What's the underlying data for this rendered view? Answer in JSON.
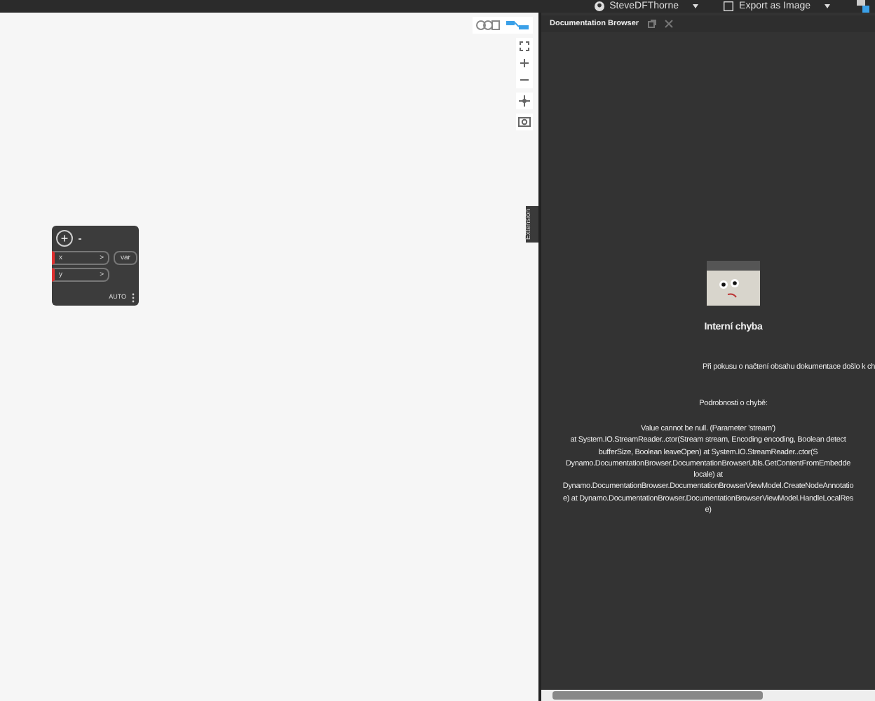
{
  "top_bar": {
    "user": "SteveDFThorne",
    "export": "Export as Image"
  },
  "node": {
    "inputs": [
      {
        "name": "x",
        "arrow": ">"
      },
      {
        "name": "y",
        "arrow": ">"
      }
    ],
    "output": "var",
    "lacing": "AUTO",
    "add_port": "+"
  },
  "side_tab": "Extension",
  "doc_panel": {
    "tab": "Documentation Browser",
    "title": "Interní chyba",
    "message": "Při pokusu o načtení obsahu dokumentace došlo k ch",
    "details_heading": "Podrobnosti o chybě:",
    "details": [
      "Value cannot be null. (Parameter 'stream')",
      "at System.IO.StreamReader..ctor(Stream stream, Encoding encoding, Boolean detect",
      "bufferSize, Boolean leaveOpen) at System.IO.StreamReader..ctor(S",
      "Dynamo.DocumentationBrowser.DocumentationBrowserUtils.GetContentFromEmbedde",
      "locale) at",
      "Dynamo.DocumentationBrowser.DocumentationBrowserViewModel.CreateNodeAnnotatio",
      "e) at Dynamo.DocumentationBrowser.DocumentationBrowserViewModel.HandleLocalRes",
      "e)"
    ]
  }
}
